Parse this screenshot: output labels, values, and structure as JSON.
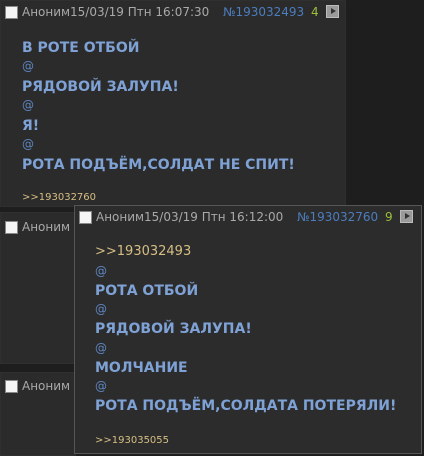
{
  "post1": {
    "name": "Аноним",
    "date": "15/03/19 Птн 16:07:30",
    "number": "№193032493",
    "replies": "4",
    "lines": [
      "В РОТЕ ОТБОЙ",
      "@",
      "РЯДОВОЙ ЗАЛУПА!",
      "@",
      "Я!",
      "@",
      "РОТА ПОДЪЁМ,СОЛДАТ НЕ СПИТ!"
    ],
    "reply_link": ">>193032760"
  },
  "post2": {
    "name": "Аноним"
  },
  "post3": {
    "name": "Аноним"
  },
  "popup": {
    "name": "Аноним",
    "date": "15/03/19 Птн 16:12:00",
    "number": "№193032760",
    "replies": "9",
    "quote_link": ">>193032493",
    "lines": [
      "РОТА ОТБОЙ",
      "@",
      "РЯДОВОЙ ЗАЛУПА!",
      "@",
      "МОЛЧАНИЕ",
      "@",
      "РОТА ПОДЪЁМ,СОЛДАТА ПОТЕРЯЛИ!"
    ],
    "reply_link": ">>193035055"
  },
  "colors": {
    "background": "#1e1e1e",
    "post_background": "#2b2b2b",
    "post_number": "#4c7dbd",
    "reply_count": "#9bbf3a",
    "text_bold": "#7fa2d6",
    "link": "#d6bf85"
  }
}
